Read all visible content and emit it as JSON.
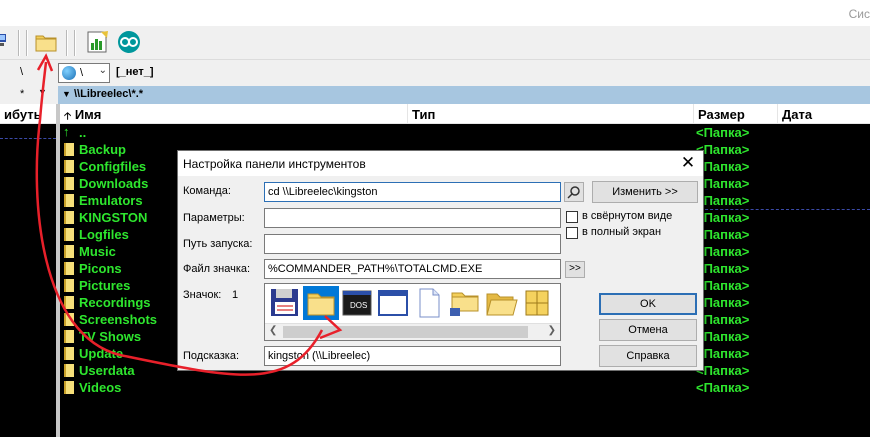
{
  "window": {
    "title_fragment": "Сис"
  },
  "drivebar": {
    "left_path": "\\",
    "drive_letter": "\\",
    "drive_label": "[_нет_]"
  },
  "left_panel": {
    "path_star": "*",
    "col_header": "ибуть"
  },
  "right_panel": {
    "path": "\\\\Libreelec\\*.*",
    "columns": {
      "name": "Имя",
      "type": "Тип",
      "size": "Размер",
      "date": "Дата"
    },
    "rows": [
      {
        "name": "..",
        "size": "<Папка>",
        "up": true
      },
      {
        "name": "Backup",
        "size": "<Папка>"
      },
      {
        "name": "Configfiles",
        "size": "<Папка>"
      },
      {
        "name": "Downloads",
        "size": "<Папка>"
      },
      {
        "name": "Emulators",
        "size": "<Папка>"
      },
      {
        "name": "KINGSTON",
        "size": "<Папка>"
      },
      {
        "name": "Logfiles",
        "size": "<Папка>"
      },
      {
        "name": "Music",
        "size": "<Папка>"
      },
      {
        "name": "Picons",
        "size": "<Папка>"
      },
      {
        "name": "Pictures",
        "size": "<Папка>"
      },
      {
        "name": "Recordings",
        "size": "<Папка>"
      },
      {
        "name": "Screenshots",
        "size": "<Папка>"
      },
      {
        "name": "TV Shows",
        "size": "<Папка>"
      },
      {
        "name": "Update",
        "size": "<Папка>"
      },
      {
        "name": "Userdata",
        "size": "<Папка>"
      },
      {
        "name": "Videos",
        "size": "<Папка>"
      }
    ]
  },
  "dialog": {
    "title": "Настройка панели инструментов",
    "command_label": "Команда:",
    "command_value": "cd \\\\Libreelec\\kingston",
    "params_label": "Параметры:",
    "params_value": "",
    "startpath_label": "Путь запуска:",
    "startpath_value": "",
    "iconfile_label": "Файл значка:",
    "iconfile_value": "%COMMANDER_PATH%\\TOTALCMD.EXE",
    "icon_label": "Значок:",
    "icon_index": "1",
    "tooltip_label": "Подсказка:",
    "tooltip_value": "kingston (\\\\Libreelec)",
    "change_button": "Изменить >>",
    "browse_button": ">>",
    "minimized_label": "в свёрнутом виде",
    "fullscreen_label": "в полный экран",
    "ok_button": "OK",
    "cancel_button": "Отмена",
    "help_button": "Справка",
    "icons": [
      "floppy-icon",
      "folder-icon",
      "dos-icon",
      "window-icon",
      "document-icon",
      "network-folder-icon",
      "open-folder-icon",
      "grid-icon"
    ]
  },
  "colors": {
    "file_green": "#2ee62e",
    "path_blue": "#a7c6e0",
    "arrow_red": "#e8202a",
    "select_blue": "#0078d7"
  }
}
